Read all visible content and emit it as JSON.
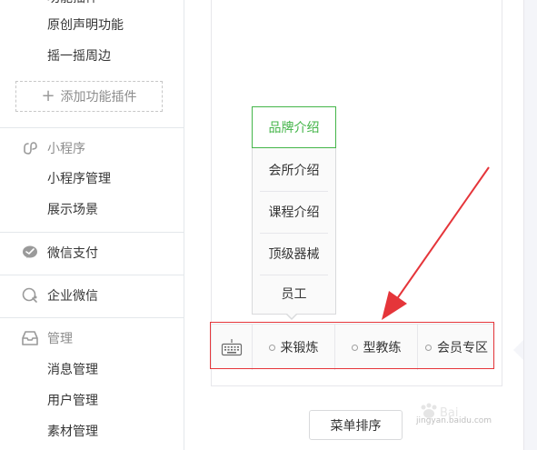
{
  "sidebar": {
    "cut_top_label": "功能插件",
    "items_top": [
      {
        "label": "原创声明功能"
      },
      {
        "label": "摇一摇周边"
      }
    ],
    "add_plugin": "添加功能插件",
    "mini_program": {
      "title": "小程序",
      "items": [
        {
          "label": "小程序管理"
        },
        {
          "label": "展示场景"
        }
      ]
    },
    "wechat_pay": {
      "title": "微信支付"
    },
    "work_wechat": {
      "title": "企业微信"
    },
    "manage": {
      "title": "管理",
      "items": [
        {
          "label": "消息管理"
        },
        {
          "label": "用户管理"
        },
        {
          "label": "素材管理"
        }
      ]
    }
  },
  "submenu": {
    "items": [
      {
        "label": "品牌介绍",
        "active": true
      },
      {
        "label": "会所介绍"
      },
      {
        "label": "课程介绍"
      },
      {
        "label": "顶级器械"
      },
      {
        "label": "员工"
      }
    ]
  },
  "menubar": {
    "items": [
      {
        "label": "来锻炼"
      },
      {
        "label": "型教练"
      },
      {
        "label": "会员专区"
      }
    ]
  },
  "sort_button": "菜单排序",
  "watermark": {
    "text": "jingyan.baidu.com"
  },
  "colors": {
    "accent": "#44b549",
    "annotation": "#e5353a"
  }
}
